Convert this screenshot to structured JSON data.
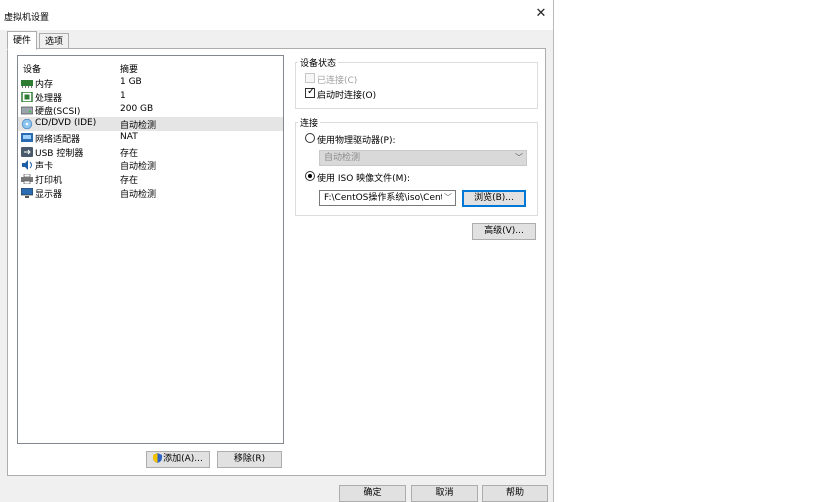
{
  "window": {
    "title": "虚拟机设置",
    "close_glyph": "✕"
  },
  "tabs": [
    {
      "label": "硬件"
    },
    {
      "label": "选项"
    }
  ],
  "device_list": {
    "headers": {
      "device": "设备",
      "summary": "摘要"
    },
    "rows": [
      {
        "name": "内存",
        "summary": "1 GB",
        "icon": "memory-icon"
      },
      {
        "name": "处理器",
        "summary": "1",
        "icon": "processor-icon"
      },
      {
        "name": "硬盘(SCSI)",
        "summary": "200 GB",
        "icon": "harddisk-icon"
      },
      {
        "name": "CD/DVD (IDE)",
        "summary": "自动检测",
        "icon": "cdrom-icon",
        "selected": true
      },
      {
        "name": "网络适配器",
        "summary": "NAT",
        "icon": "network-adapter-icon"
      },
      {
        "name": "USB 控制器",
        "summary": "存在",
        "icon": "usb-icon"
      },
      {
        "name": "声卡",
        "summary": "自动检测",
        "icon": "sound-card-icon"
      },
      {
        "name": "打印机",
        "summary": "存在",
        "icon": "printer-icon"
      },
      {
        "name": "显示器",
        "summary": "自动检测",
        "icon": "display-icon"
      }
    ]
  },
  "device_buttons": {
    "add": "添加(A)...",
    "remove": "移除(R)"
  },
  "device_status": {
    "title": "设备状态",
    "connected": {
      "label": "已连接(C)",
      "checked": false,
      "disabled": true
    },
    "connect_at_power_on": {
      "label": "启动时连接(O)",
      "checked": true
    }
  },
  "connection": {
    "title": "连接",
    "physical_drive": {
      "label": "使用物理驱动器(P):",
      "selected": false
    },
    "physical_drive_select": {
      "value": "自动检测"
    },
    "iso_image": {
      "label": "使用 ISO 映像文件(M):",
      "selected": true
    },
    "iso_path": {
      "value": "F:\\CentOS操作系统\\iso\\Cent"
    },
    "browse_label": "浏览(B)..."
  },
  "advanced_label": "高级(V)...",
  "footer": {
    "ok": "确定",
    "cancel": "取消",
    "help": "帮助"
  },
  "colors": {
    "accent": "#0078d7",
    "selected_row": "#e5e5e5",
    "dialog_bg": "#f0f0f0"
  }
}
